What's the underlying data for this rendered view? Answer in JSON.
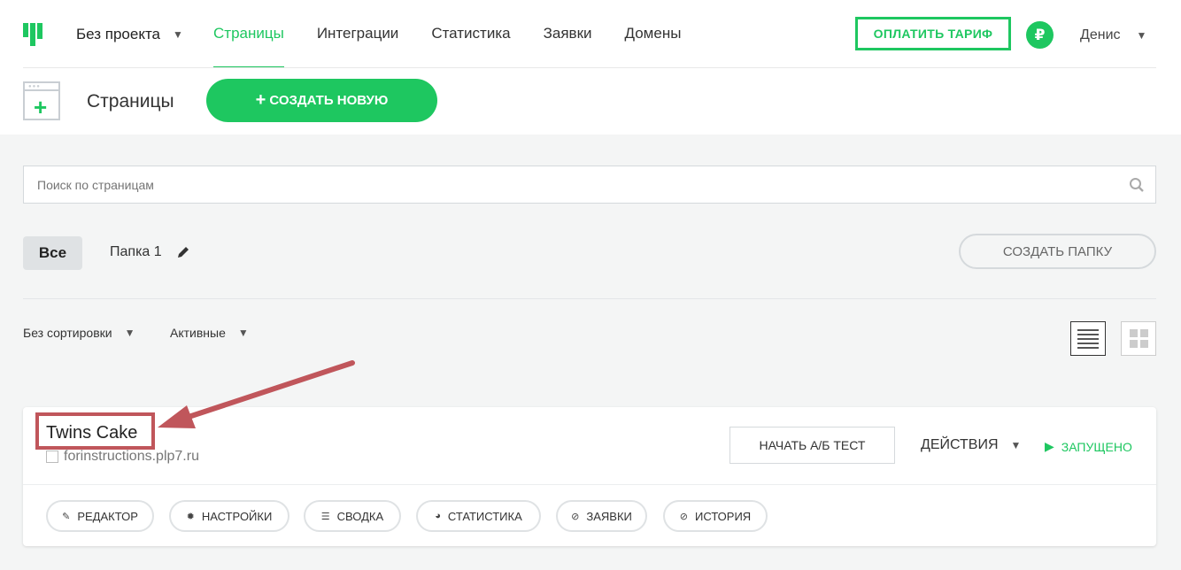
{
  "nav": {
    "project": "Без проекта",
    "menu": [
      "Страницы",
      "Интеграции",
      "Статистика",
      "Заявки",
      "Домены"
    ],
    "pay_label": "ОПЛАТИТЬ ТАРИФ",
    "currency_symbol": "₽",
    "user": "Денис"
  },
  "header": {
    "title": "Страницы",
    "create_label": "СОЗДАТЬ НОВУЮ",
    "create_plus": "+"
  },
  "search": {
    "placeholder": "Поиск по страницам"
  },
  "folders": {
    "all": "Все",
    "folder1": "Папка 1",
    "create_folder": "СОЗДАТЬ ПАПКУ"
  },
  "filters": {
    "sort": "Без сортировки",
    "status": "Активные"
  },
  "card": {
    "title": "Twins Cake",
    "url": "forinstructions.plp7.ru",
    "ab_test": "НАЧАТЬ А/Б ТЕСТ",
    "actions": "ДЕЙСТВИЯ",
    "status": "ЗАПУЩЕНО",
    "tools": [
      {
        "label": "РЕДАКТОР",
        "icon": "edit-icon"
      },
      {
        "label": "НАСТРОЙКИ",
        "icon": "gear-icon"
      },
      {
        "label": "СВОДКА",
        "icon": "list-icon"
      },
      {
        "label": "СТАТИСТИКА",
        "icon": "pie-chart-icon"
      },
      {
        "label": "ЗАЯВКИ",
        "icon": "check-circle-icon"
      },
      {
        "label": "ИСТОРИЯ",
        "icon": "check-circle-icon"
      }
    ]
  },
  "colors": {
    "accent": "#1ec760",
    "annotation": "#c0565b"
  }
}
